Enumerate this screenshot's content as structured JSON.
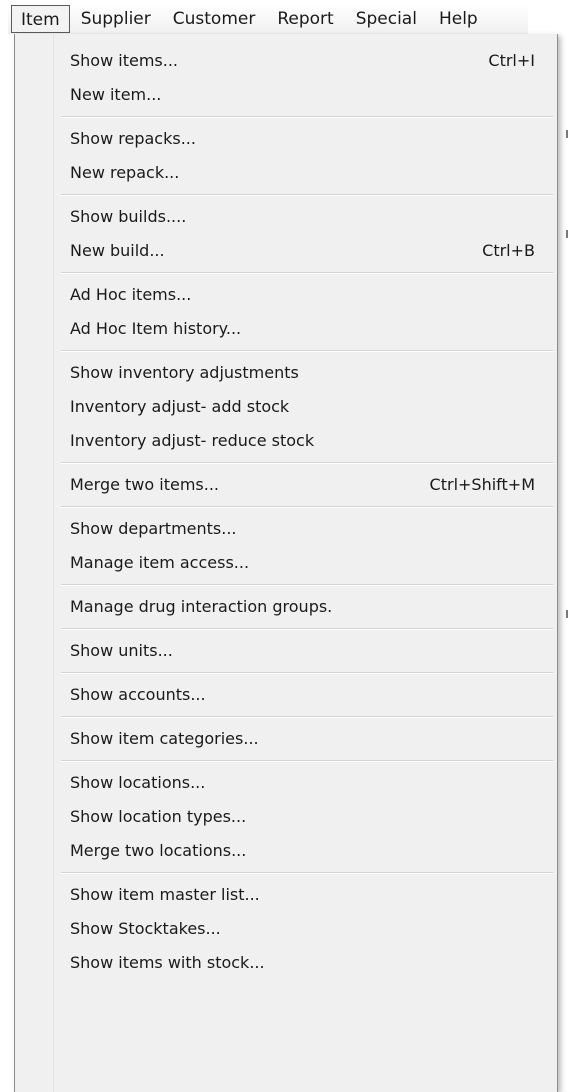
{
  "menubar": {
    "items": [
      {
        "label": "Item"
      },
      {
        "label": "Supplier"
      },
      {
        "label": "Customer"
      },
      {
        "label": "Report"
      },
      {
        "label": "Special"
      },
      {
        "label": "Help"
      }
    ]
  },
  "item_menu": {
    "groups": [
      {
        "items": [
          {
            "label": "Show items...",
            "shortcut": "Ctrl+I"
          },
          {
            "label": "New item...",
            "shortcut": ""
          }
        ]
      },
      {
        "items": [
          {
            "label": "Show repacks...",
            "shortcut": ""
          },
          {
            "label": "New repack...",
            "shortcut": ""
          }
        ]
      },
      {
        "items": [
          {
            "label": "Show builds....",
            "shortcut": ""
          },
          {
            "label": "New build...",
            "shortcut": "Ctrl+B"
          }
        ]
      },
      {
        "items": [
          {
            "label": "Ad Hoc items...",
            "shortcut": ""
          },
          {
            "label": "Ad Hoc Item history...",
            "shortcut": ""
          }
        ]
      },
      {
        "items": [
          {
            "label": "Show inventory adjustments",
            "shortcut": ""
          },
          {
            "label": "Inventory adjust- add stock",
            "shortcut": ""
          },
          {
            "label": "Inventory adjust- reduce stock",
            "shortcut": ""
          }
        ]
      },
      {
        "items": [
          {
            "label": "Merge two items...",
            "shortcut": "Ctrl+Shift+M"
          }
        ]
      },
      {
        "items": [
          {
            "label": "Show departments...",
            "shortcut": ""
          },
          {
            "label": "Manage item access...",
            "shortcut": ""
          }
        ]
      },
      {
        "items": [
          {
            "label": "Manage drug interaction groups.",
            "shortcut": ""
          }
        ]
      },
      {
        "items": [
          {
            "label": "Show units...",
            "shortcut": ""
          }
        ]
      },
      {
        "items": [
          {
            "label": "Show accounts...",
            "shortcut": ""
          }
        ]
      },
      {
        "items": [
          {
            "label": "Show item categories...",
            "shortcut": ""
          }
        ]
      },
      {
        "items": [
          {
            "label": "Show locations...",
            "shortcut": ""
          },
          {
            "label": "Show location types...",
            "shortcut": ""
          },
          {
            "label": "Merge two locations...",
            "shortcut": ""
          }
        ]
      },
      {
        "items": [
          {
            "label": "Show item master list...",
            "shortcut": ""
          },
          {
            "label": "Show Stocktakes...",
            "shortcut": ""
          },
          {
            "label": "Show items with stock...",
            "shortcut": ""
          }
        ]
      }
    ]
  }
}
